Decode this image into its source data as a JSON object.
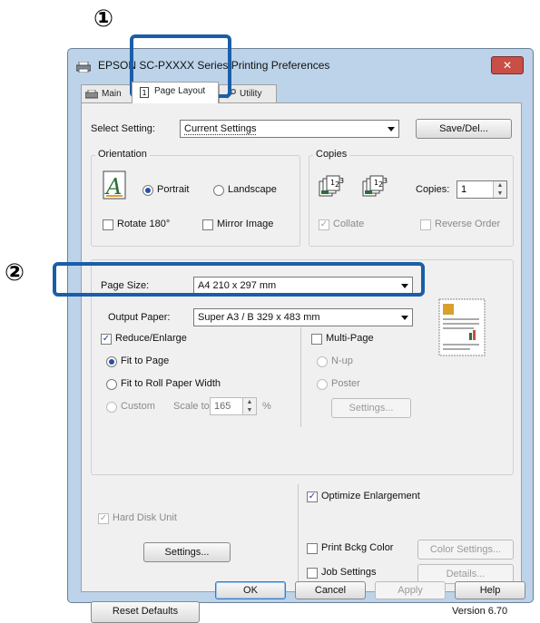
{
  "callouts": {
    "one": "①",
    "two": "②"
  },
  "window": {
    "title": "EPSON SC-PXXXX Series Printing Preferences",
    "close_label": "✕"
  },
  "tabs": [
    {
      "label": "Main"
    },
    {
      "label": "Page Layout"
    },
    {
      "label": "Utility"
    }
  ],
  "select_setting": {
    "label": "Select Setting:",
    "value": "Current Settings",
    "save_button": "Save/Del..."
  },
  "orientation": {
    "title": "Orientation",
    "portrait": "Portrait",
    "landscape": "Landscape",
    "rotate": "Rotate 180°",
    "mirror": "Mirror Image"
  },
  "copies": {
    "title": "Copies",
    "label": "Copies:",
    "value": "1",
    "collate": "Collate",
    "reverse": "Reverse Order"
  },
  "layout": {
    "page_size_label": "Page Size:",
    "page_size_value": "A4 210 x 297 mm",
    "output_paper_label": "Output Paper:",
    "output_paper_value": "Super A3 / B 329 x 483 mm",
    "reduce_enlarge": "Reduce/Enlarge",
    "fit_to_page": "Fit to Page",
    "fit_roll": "Fit to Roll Paper Width",
    "custom": "Custom",
    "scale_to": "Scale to",
    "scale_value": "165",
    "percent": "%",
    "multi_page": "Multi-Page",
    "n_up": "N-up",
    "poster": "Poster",
    "settings_button": "Settings..."
  },
  "lower": {
    "optimize": "Optimize Enlargement",
    "hard_disk": "Hard Disk Unit",
    "settings_button": "Settings...",
    "print_bckg": "Print Bckg Color",
    "color_settings": "Color Settings...",
    "job_settings": "Job Settings",
    "details": "Details...",
    "reset_defaults": "Reset Defaults",
    "version": "Version 6.70"
  },
  "footer": {
    "ok": "OK",
    "cancel": "Cancel",
    "apply": "Apply",
    "help": "Help"
  }
}
